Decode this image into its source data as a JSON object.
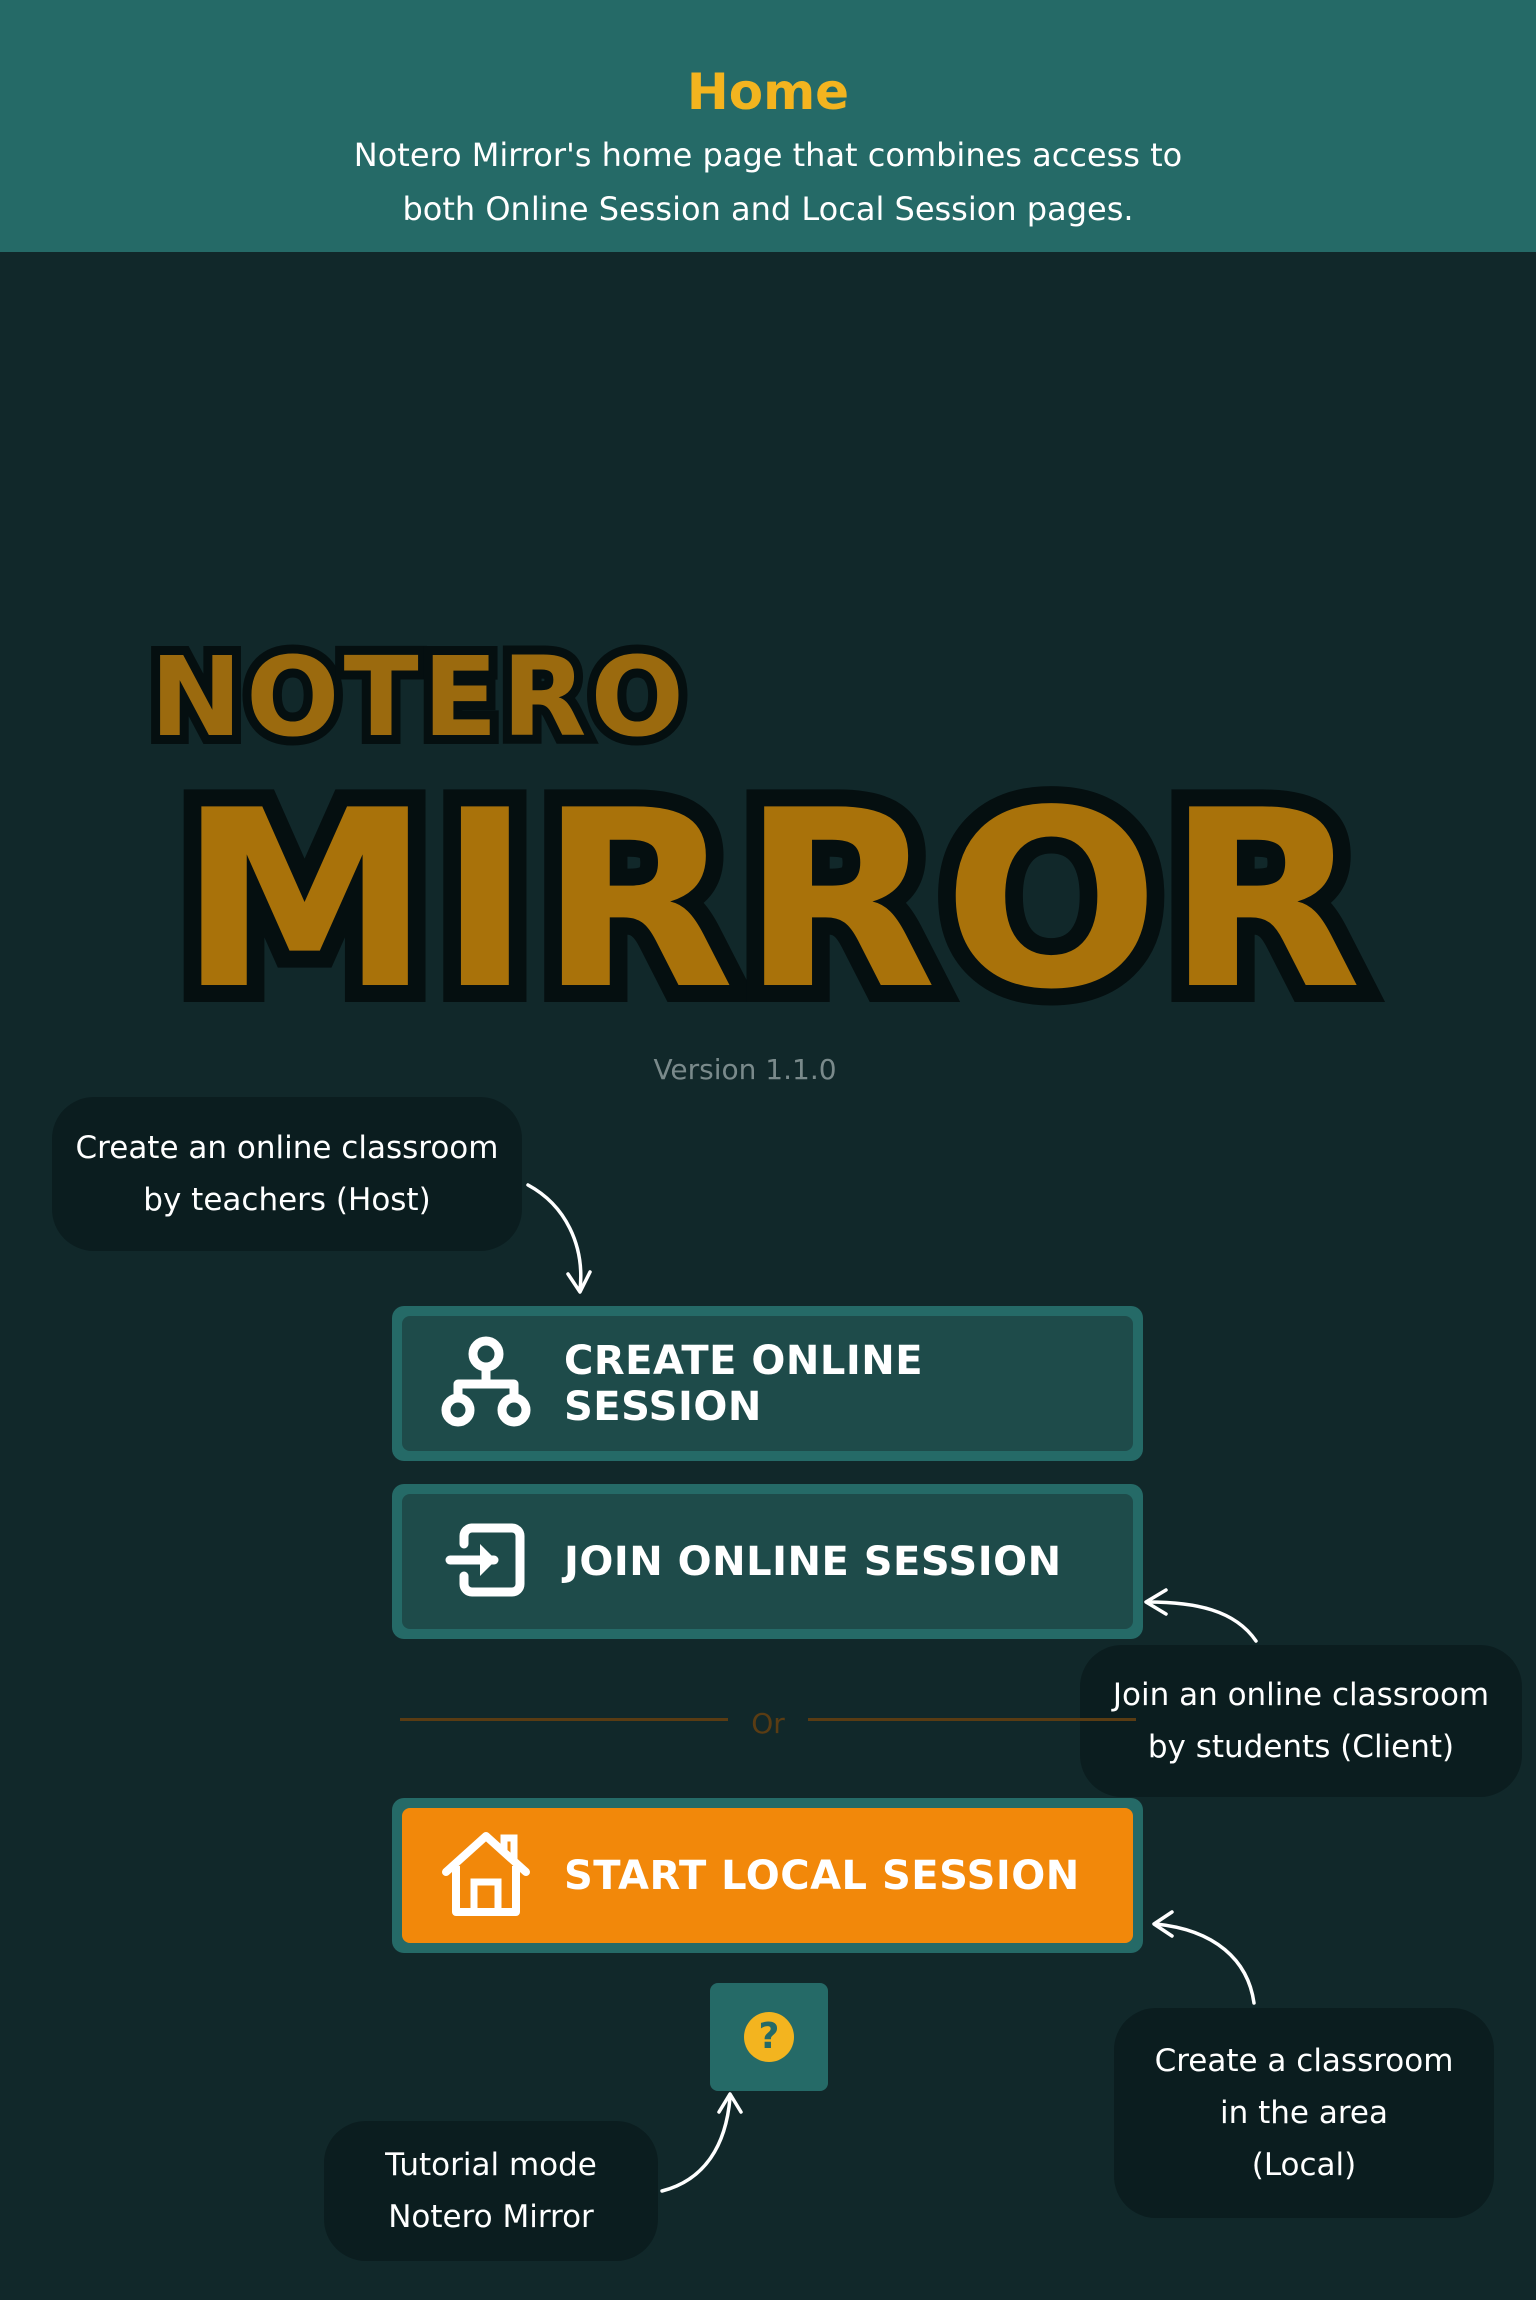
{
  "header": {
    "title": "Home",
    "description": "Notero Mirror's home page that combines access to both Online Session and Local Session pages."
  },
  "logo": {
    "top_word": "NOTERO",
    "main_word": "MIRROR"
  },
  "version": "Version 1.1.0",
  "callouts": {
    "create_online": "Create an online classroom\nby teachers (Host)",
    "join_online": "Join an online classroom\nby students (Client)",
    "local": "Create a classroom\nin the area\n(Local)",
    "tutorial": "Tutorial mode\nNotero Mirror"
  },
  "buttons": {
    "create_online": "CREATE ONLINE SESSION",
    "join_online": "JOIN ONLINE SESSION",
    "start_local": "START LOCAL SESSION",
    "help_symbol": "?"
  },
  "divider_text": "Or",
  "icons": {
    "create_online": "network-hierarchy-icon",
    "join_online": "login-icon",
    "start_local": "home-icon",
    "help": "question-circle-icon"
  },
  "colors": {
    "background": "#11282a",
    "header_bg": "#256a67",
    "accent_yellow": "#f3b41f",
    "local_button": "#f2880a",
    "button_inner": "#1e4b4a"
  }
}
